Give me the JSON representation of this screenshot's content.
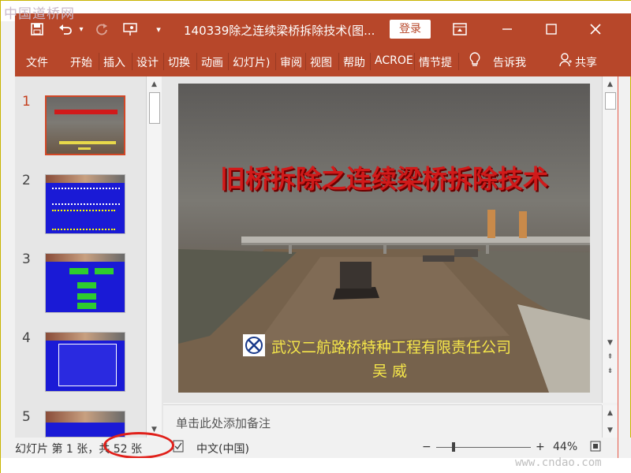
{
  "watermark_top": "中国道桥网",
  "watermark_bottom": "www.cndao.com",
  "titlebar": {
    "doc_title": "140339除之连续梁桥拆除技术(图...",
    "login": "登录",
    "icons": [
      "save-icon",
      "undo-icon",
      "redo-icon",
      "present-icon",
      "customize-icon",
      "ribbon-display-icon",
      "minimize-icon",
      "maximize-icon",
      "close-icon"
    ]
  },
  "ribbon": {
    "tabs": [
      "文件",
      "开始",
      "插入",
      "设计",
      "切换",
      "动画",
      "幻灯片)",
      "审阅",
      "视图",
      "帮助",
      "ACROE",
      "情节提",
      "告诉我",
      "共享"
    ]
  },
  "thumbs": [
    {
      "num": "1"
    },
    {
      "num": "2"
    },
    {
      "num": "3"
    },
    {
      "num": "4"
    },
    {
      "num": "5"
    }
  ],
  "slide": {
    "title": "旧桥拆除之连续梁桥拆除技术",
    "company": "武汉二航路桥特种工程有限责任公司",
    "author": "吴 威"
  },
  "notes": {
    "placeholder": "单击此处添加备注"
  },
  "statusbar": {
    "slide_info": "幻灯片 第 1 张，共 52 张",
    "language": "中文(中国)",
    "zoom_minus": "−",
    "zoom_plus": "+",
    "zoom": "44%"
  },
  "colors": {
    "accent": "#b7472a",
    "active_thumb": "#d24726",
    "slide_title": "#d11a1a",
    "slide_text": "#f5e64a"
  }
}
